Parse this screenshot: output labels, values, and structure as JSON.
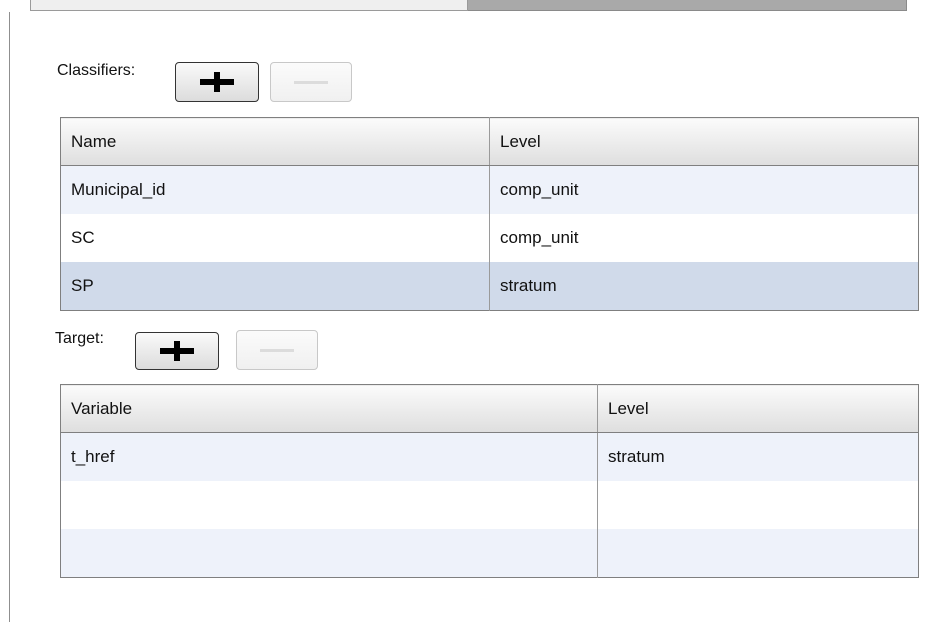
{
  "classifiers": {
    "label": "Classifiers:",
    "columns": [
      "Name",
      "Level"
    ],
    "rows": [
      {
        "name": "Municipal_id",
        "level": "comp_unit"
      },
      {
        "name": "SC",
        "level": "comp_unit"
      },
      {
        "name": "SP",
        "level": "stratum"
      }
    ]
  },
  "target": {
    "label": "Target:",
    "columns": [
      "Variable",
      "Level"
    ],
    "rows": [
      {
        "variable": "t_href",
        "level": "stratum"
      },
      {
        "variable": "",
        "level": ""
      },
      {
        "variable": "",
        "level": ""
      }
    ]
  }
}
